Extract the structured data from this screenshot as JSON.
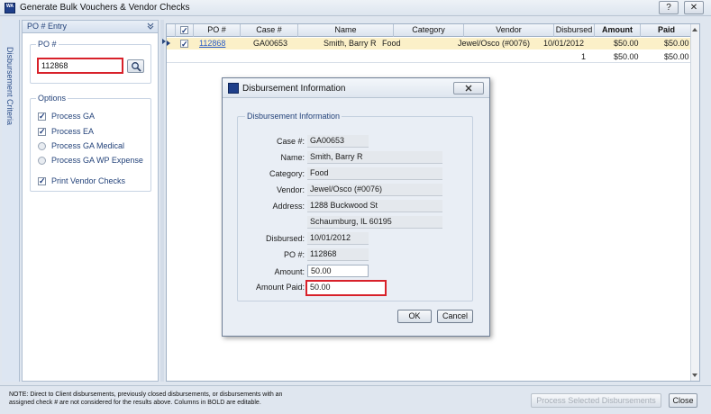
{
  "window": {
    "title": "Generate Bulk Vouchers & Vendor Checks",
    "help_label": "?",
    "close_label": "✕",
    "app_icon_text": "WA"
  },
  "side_tab": {
    "label": "Disbursement Criteria"
  },
  "left_panel": {
    "header": "PO # Entry",
    "po_group_label": "PO #",
    "po_value": "112868",
    "options_label": "Options",
    "options": [
      {
        "label": "Process GA",
        "type": "checkbox",
        "checked": true
      },
      {
        "label": "Process EA",
        "type": "checkbox",
        "checked": true
      },
      {
        "label": "Process GA Medical",
        "type": "radio",
        "checked": false
      },
      {
        "label": "Process GA WP Expense",
        "type": "radio",
        "checked": false
      },
      {
        "label": "Print Vendor Checks",
        "type": "checkbox",
        "checked": true
      }
    ]
  },
  "grid": {
    "columns": [
      "",
      "PO #",
      "Case #",
      "Name",
      "Category",
      "Vendor",
      "Disbursed",
      "Amount",
      "Paid"
    ],
    "rows": [
      {
        "po": "112868",
        "case": "GA00653",
        "name": "Smith, Barry R",
        "category": "Food",
        "vendor": "Jewel/Osco (#0076)",
        "disbursed": "10/01/2012",
        "amount": "$50.00",
        "paid": "$50.00"
      }
    ],
    "totals": {
      "count": "1",
      "amount": "$50.00",
      "paid": "$50.00"
    }
  },
  "dialog": {
    "title": "Disbursement Information",
    "group_label": "Disbursement Information",
    "fields": {
      "case_label": "Case #:",
      "case": "GA00653",
      "name_label": "Name:",
      "name": "Smith, Barry R",
      "category_label": "Category:",
      "category": "Food",
      "vendor_label": "Vendor:",
      "vendor": "Jewel/Osco (#0076)",
      "address_label": "Address:",
      "address1": "1288 Buckwood St",
      "address2": "Schaumburg, IL 60195",
      "disbursed_label": "Disbursed:",
      "disbursed": "10/01/2012",
      "po_label": "PO #:",
      "po": "112868",
      "amount_label": "Amount:",
      "amount": "50.00",
      "amount_paid_label": "Amount Paid:",
      "amount_paid": "50.00"
    },
    "ok_label": "OK",
    "cancel_label": "Cancel"
  },
  "footer": {
    "note": "NOTE: Direct to Client disbursements, previously closed disbursements, or disbursements with an assigned check # are not considered for the results above. Columns in BOLD are editable.",
    "process_label": "Process Selected Disbursements",
    "close_label": "Close"
  }
}
